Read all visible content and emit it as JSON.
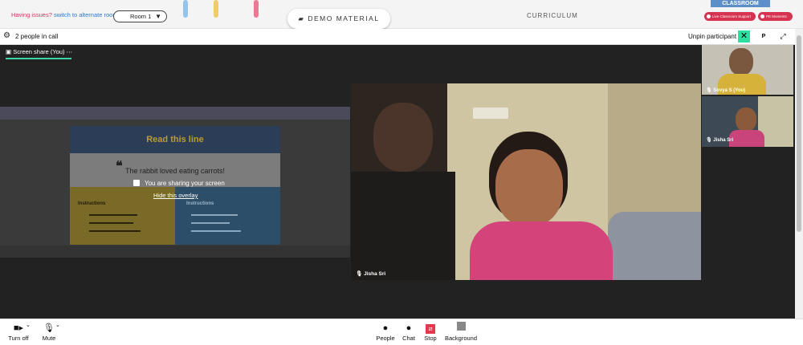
{
  "topbar": {
    "issues_prefix": "Having issues?",
    "issues_link": "switch to alternate room",
    "room": "Room 1",
    "demo_button": "DEMO MATERIAL",
    "curriculum": "CURRICULUM",
    "classroom_tab": "CLASSROOM",
    "support_button": "Live Classroom Support",
    "moments_button": "PE Moments"
  },
  "callbar": {
    "people_count": "2 people in call",
    "unpin": "Unpin participant",
    "p_button": "P"
  },
  "screenshare": {
    "tab_label": "Screen share (You)",
    "slide_title": "Read this line",
    "slide_quote": "The rabbit loved eating carrots!",
    "left_head": "Instructions",
    "right_head": "Instructions",
    "overlay_message": "You are sharing your screen",
    "overlay_link": "Hide this overlay"
  },
  "participants": {
    "main_name": "Jisha Sri",
    "thumb1_name": "Sovya S (You)",
    "thumb2_name": "Jisha Sri"
  },
  "controls": {
    "turn_off": "Turn off",
    "mute": "Mute",
    "people": "People",
    "chat": "Chat",
    "stop": "Stop",
    "background": "Background"
  },
  "colors": {
    "accent_green": "#2de0a0",
    "alert_red": "#d63350",
    "link_blue": "#2c79c9"
  }
}
